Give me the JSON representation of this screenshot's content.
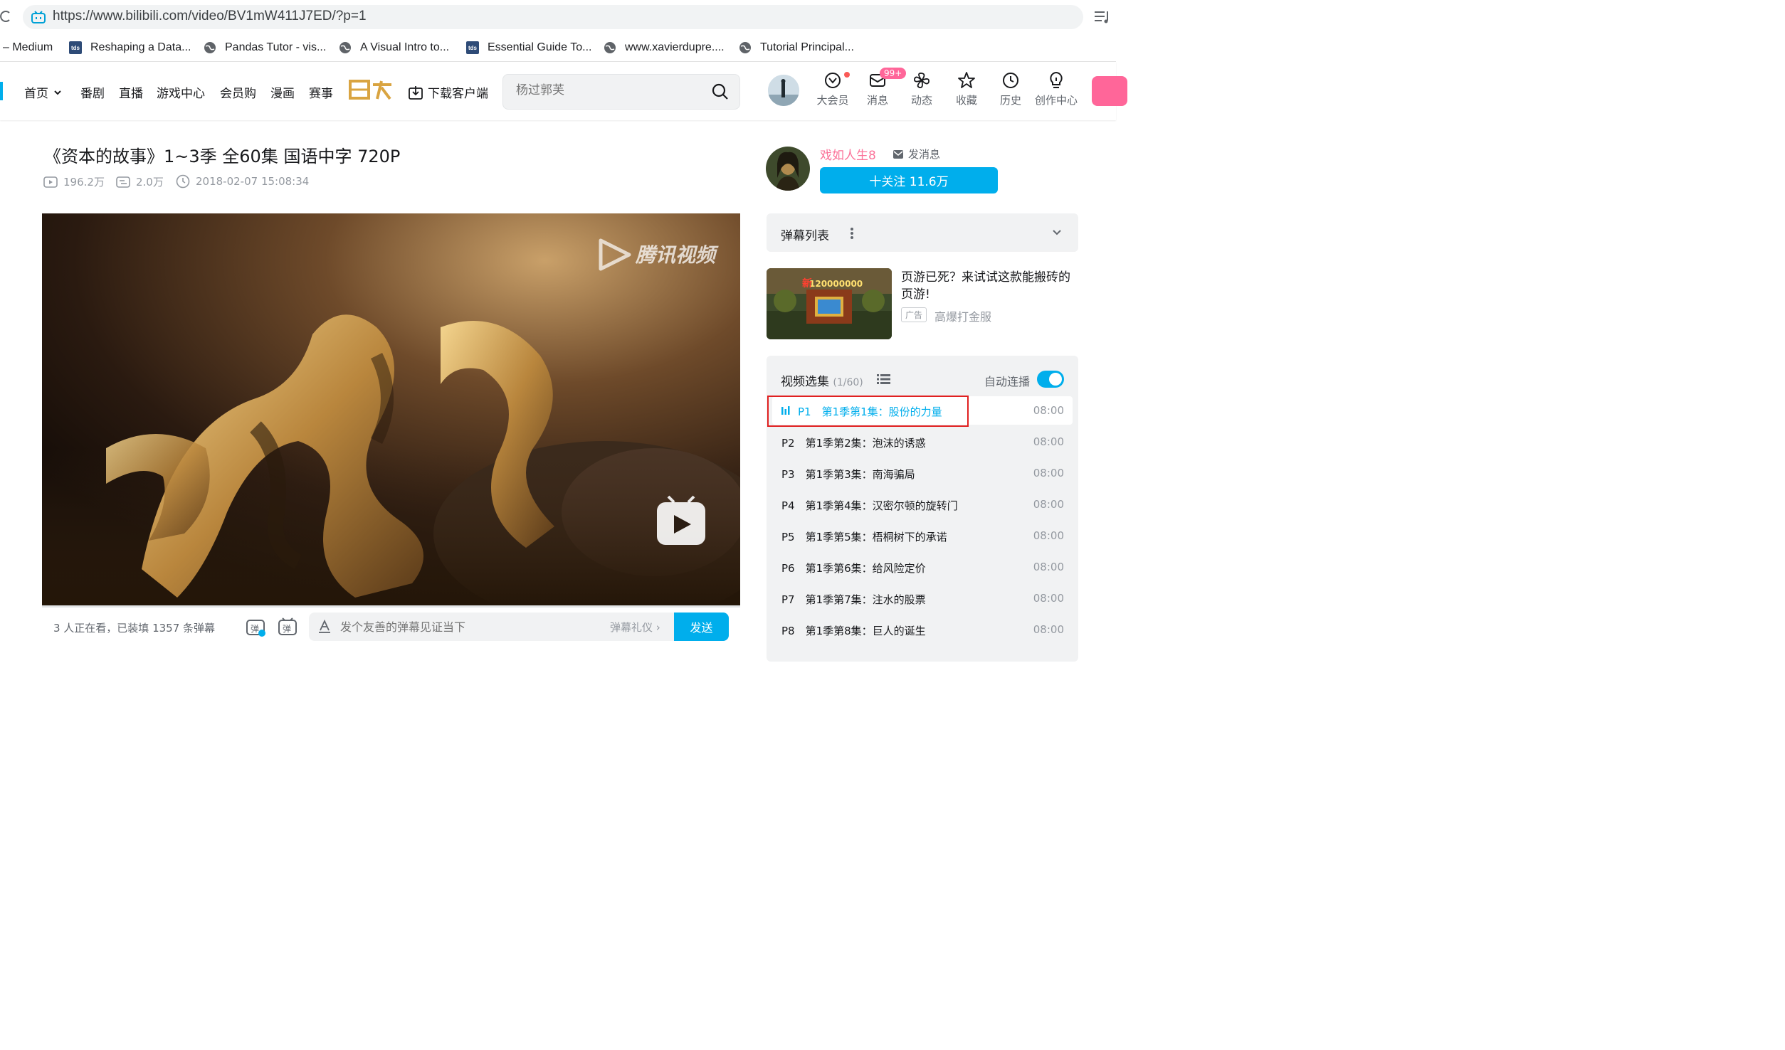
{
  "browser": {
    "url": "https://www.bilibili.com/video/BV1mW411J7ED/?p=1",
    "bookmarks": [
      {
        "icon": "",
        "label": "– Medium"
      },
      {
        "icon": "tds",
        "label": "Reshaping a Data..."
      },
      {
        "icon": "globe",
        "label": "Pandas Tutor - vis..."
      },
      {
        "icon": "globe",
        "label": "A Visual Intro to..."
      },
      {
        "icon": "tds",
        "label": "Essential Guide To..."
      },
      {
        "icon": "globe",
        "label": "www.xavierdupre...."
      },
      {
        "icon": "globe",
        "label": "Tutorial Principal..."
      }
    ]
  },
  "header": {
    "nav": [
      "首页",
      "番剧",
      "直播",
      "游戏中心",
      "会员购",
      "漫画",
      "赛事"
    ],
    "download": "下载客户端",
    "search_placeholder": "杨过郭芙",
    "icons": [
      {
        "label": "大会员",
        "icon": "vip-icon"
      },
      {
        "label": "消息",
        "icon": "message-icon"
      },
      {
        "label": "动态",
        "icon": "dynamic-icon"
      },
      {
        "label": "收藏",
        "icon": "star-icon"
      },
      {
        "label": "历史",
        "icon": "clock-icon"
      },
      {
        "label": "创作中心",
        "icon": "bulb-icon"
      }
    ],
    "message_badge": "99+"
  },
  "video": {
    "title": "《资本的故事》1~3季 全60集 国语中字 720P",
    "views": "196.2万",
    "danmaku_count": "2.0万",
    "date": "2018-02-07 15:08:34",
    "watermark": "腾讯视频"
  },
  "controls": {
    "watching": "3 人正在看，已装填 1357 条弹幕",
    "danmaku_placeholder": "发个友善的弹幕见证当下",
    "etiquette": "弹幕礼仪",
    "send": "发送"
  },
  "uploader": {
    "name": "戏如人生8",
    "message": "发消息",
    "follow": "十关注 11.6万"
  },
  "danmaku_list": {
    "title": "弹幕列表"
  },
  "ad": {
    "title": "页游已死？来试试这款能搬砖的页游!",
    "tag": "广告",
    "subtitle": "高爆打金服"
  },
  "episodes": {
    "title": "视频选集",
    "count": "(1/60)",
    "autoplay": "自动连播",
    "items": [
      {
        "label": "P1　第1季第1集：股份的力量",
        "duration": "08:00"
      },
      {
        "label": "P2　第1季第2集：泡沫的诱惑",
        "duration": "08:00"
      },
      {
        "label": "P3　第1季第3集：南海骗局",
        "duration": "08:00"
      },
      {
        "label": "P4　第1季第4集：汉密尔顿的旋转门",
        "duration": "08:00"
      },
      {
        "label": "P5　第1季第5集：梧桐树下的承诺",
        "duration": "08:00"
      },
      {
        "label": "P6　第1季第6集：给风险定价",
        "duration": "08:00"
      },
      {
        "label": "P7　第1季第7集：注水的股票",
        "duration": "08:00"
      },
      {
        "label": "P8　第1季第8集：巨人的诞生",
        "duration": "08:00"
      }
    ]
  }
}
